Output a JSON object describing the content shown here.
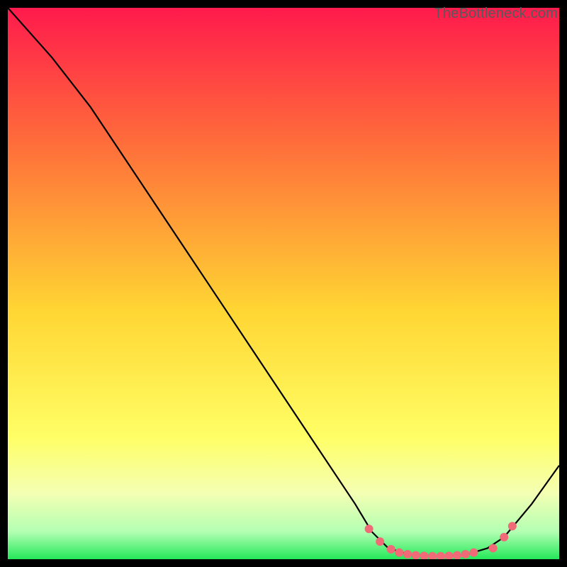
{
  "watermark": "TheBottleneck.com",
  "chart_data": {
    "type": "line",
    "title": "",
    "xlabel": "",
    "ylabel": "",
    "xlim": [
      0,
      100
    ],
    "ylim": [
      0,
      100
    ],
    "gradient_stops": [
      {
        "offset": 0.0,
        "color": "#ff1a4c"
      },
      {
        "offset": 0.25,
        "color": "#ff6f3a"
      },
      {
        "offset": 0.55,
        "color": "#ffd633"
      },
      {
        "offset": 0.78,
        "color": "#ffff66"
      },
      {
        "offset": 0.88,
        "color": "#f4ffb3"
      },
      {
        "offset": 0.95,
        "color": "#b3ffb3"
      },
      {
        "offset": 1.0,
        "color": "#24e859"
      }
    ],
    "curve": [
      {
        "x": 0.0,
        "y": 100.0
      },
      {
        "x": 8.0,
        "y": 91.0
      },
      {
        "x": 15.0,
        "y": 82.0
      },
      {
        "x": 25.0,
        "y": 67.0
      },
      {
        "x": 35.0,
        "y": 52.0
      },
      {
        "x": 45.0,
        "y": 37.0
      },
      {
        "x": 55.0,
        "y": 22.0
      },
      {
        "x": 63.0,
        "y": 10.0
      },
      {
        "x": 66.0,
        "y": 5.0
      },
      {
        "x": 69.0,
        "y": 2.0
      },
      {
        "x": 73.0,
        "y": 0.8
      },
      {
        "x": 78.0,
        "y": 0.5
      },
      {
        "x": 83.0,
        "y": 0.8
      },
      {
        "x": 87.0,
        "y": 2.0
      },
      {
        "x": 90.0,
        "y": 4.0
      },
      {
        "x": 95.0,
        "y": 10.0
      },
      {
        "x": 100.0,
        "y": 17.0
      }
    ],
    "markers": [
      {
        "x": 65.5,
        "y": 5.5
      },
      {
        "x": 67.5,
        "y": 3.2
      },
      {
        "x": 69.5,
        "y": 1.8
      },
      {
        "x": 71.0,
        "y": 1.2
      },
      {
        "x": 72.5,
        "y": 0.9
      },
      {
        "x": 74.0,
        "y": 0.7
      },
      {
        "x": 75.5,
        "y": 0.6
      },
      {
        "x": 77.0,
        "y": 0.55
      },
      {
        "x": 78.5,
        "y": 0.55
      },
      {
        "x": 80.0,
        "y": 0.6
      },
      {
        "x": 81.5,
        "y": 0.7
      },
      {
        "x": 83.0,
        "y": 0.9
      },
      {
        "x": 84.5,
        "y": 1.2
      },
      {
        "x": 88.0,
        "y": 2.0
      },
      {
        "x": 90.0,
        "y": 4.0
      },
      {
        "x": 91.5,
        "y": 6.0
      }
    ],
    "marker_color": "#f06a78",
    "line_color": "#000000"
  }
}
